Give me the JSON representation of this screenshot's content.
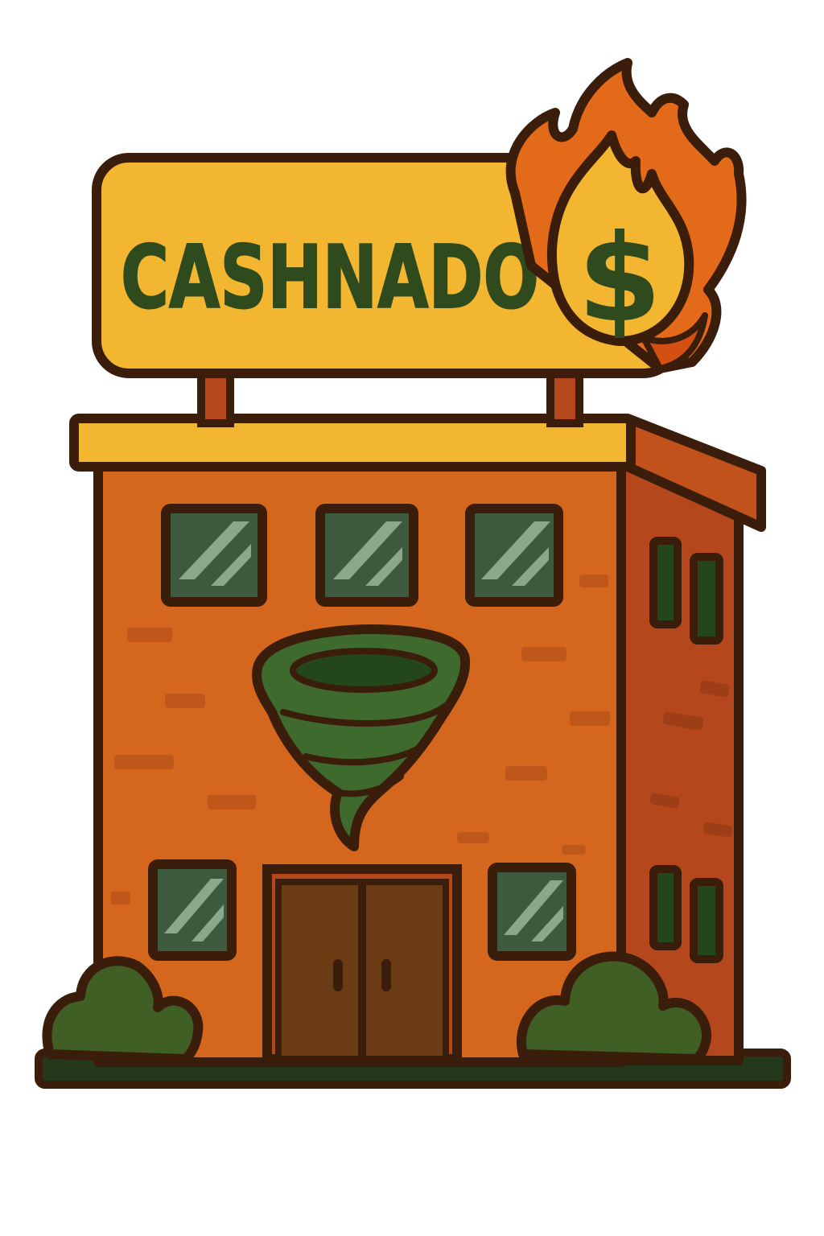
{
  "sign": {
    "text": "CASHNADO",
    "symbol": "$"
  },
  "colors": {
    "outline": "#3b1d0c",
    "sign_yellow": "#f2b630",
    "sign_text_green": "#2f4a1c",
    "brick_orange": "#d4661e",
    "brick_shadow": "#a8441a",
    "side_wall": "#b4481c",
    "window_glass": "#3d5a3f",
    "window_shine": "#8aa98a",
    "door_brown": "#6b3b14",
    "tornado_green": "#3f6a2e",
    "tornado_dark": "#24461d",
    "bush_green": "#3f5f25",
    "flame_orange": "#e36a18",
    "flame_red": "#d44f12",
    "ground_dark": "#24391c"
  },
  "icons": {
    "sign_icon": "flaming-dollar-coin-icon",
    "wall_emblem": "tornado-icon"
  }
}
